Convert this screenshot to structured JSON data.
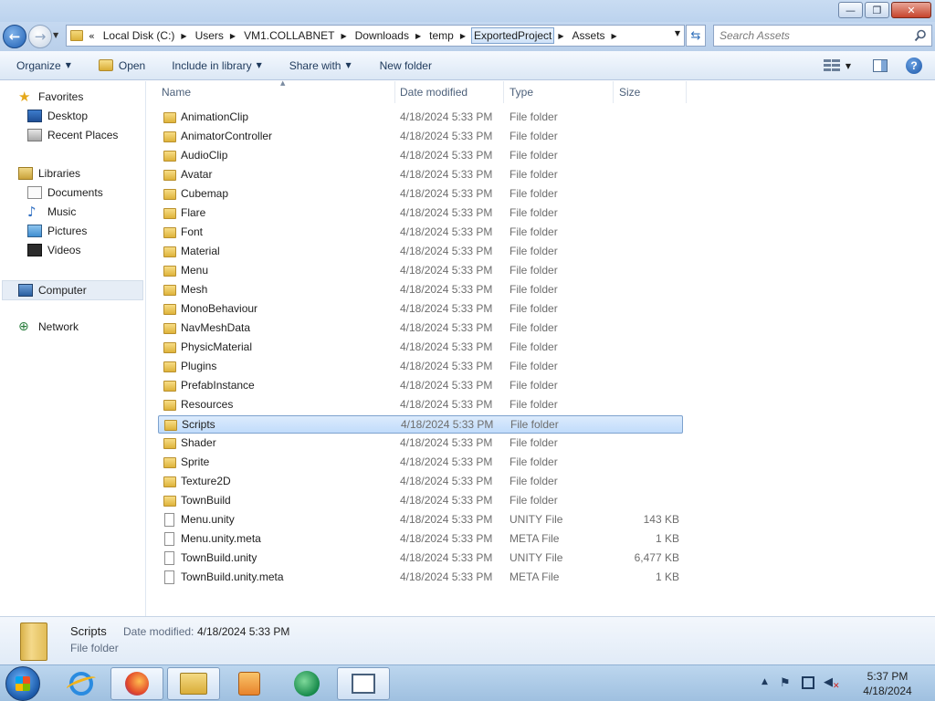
{
  "window": {
    "controls": {
      "minimize": "—",
      "maximize": "❐",
      "close": "✕"
    }
  },
  "address": {
    "overflow": "«",
    "crumbs": [
      "Local Disk (C:)",
      "Users",
      "VM1.COLLABNET",
      "Downloads",
      "temp",
      "ExportedProject",
      "Assets"
    ],
    "hover_index": 5
  },
  "search": {
    "placeholder": "Search Assets"
  },
  "toolbar": {
    "organize": "Organize",
    "open": "Open",
    "include_in_library": "Include in library",
    "share_with": "Share with",
    "new_folder": "New folder"
  },
  "nav": {
    "favorites": "Favorites",
    "desktop": "Desktop",
    "recent_places": "Recent Places",
    "libraries": "Libraries",
    "documents": "Documents",
    "music": "Music",
    "pictures": "Pictures",
    "videos": "Videos",
    "computer": "Computer",
    "network": "Network"
  },
  "columns": {
    "name": "Name",
    "date": "Date modified",
    "type": "Type",
    "size": "Size"
  },
  "files": [
    {
      "name": "AnimationClip",
      "date": "4/18/2024 5:33 PM",
      "type": "File folder",
      "size": "",
      "kind": "folder"
    },
    {
      "name": "AnimatorController",
      "date": "4/18/2024 5:33 PM",
      "type": "File folder",
      "size": "",
      "kind": "folder"
    },
    {
      "name": "AudioClip",
      "date": "4/18/2024 5:33 PM",
      "type": "File folder",
      "size": "",
      "kind": "folder"
    },
    {
      "name": "Avatar",
      "date": "4/18/2024 5:33 PM",
      "type": "File folder",
      "size": "",
      "kind": "folder"
    },
    {
      "name": "Cubemap",
      "date": "4/18/2024 5:33 PM",
      "type": "File folder",
      "size": "",
      "kind": "folder"
    },
    {
      "name": "Flare",
      "date": "4/18/2024 5:33 PM",
      "type": "File folder",
      "size": "",
      "kind": "folder"
    },
    {
      "name": "Font",
      "date": "4/18/2024 5:33 PM",
      "type": "File folder",
      "size": "",
      "kind": "folder"
    },
    {
      "name": "Material",
      "date": "4/18/2024 5:33 PM",
      "type": "File folder",
      "size": "",
      "kind": "folder"
    },
    {
      "name": "Menu",
      "date": "4/18/2024 5:33 PM",
      "type": "File folder",
      "size": "",
      "kind": "folder"
    },
    {
      "name": "Mesh",
      "date": "4/18/2024 5:33 PM",
      "type": "File folder",
      "size": "",
      "kind": "folder"
    },
    {
      "name": "MonoBehaviour",
      "date": "4/18/2024 5:33 PM",
      "type": "File folder",
      "size": "",
      "kind": "folder"
    },
    {
      "name": "NavMeshData",
      "date": "4/18/2024 5:33 PM",
      "type": "File folder",
      "size": "",
      "kind": "folder"
    },
    {
      "name": "PhysicMaterial",
      "date": "4/18/2024 5:33 PM",
      "type": "File folder",
      "size": "",
      "kind": "folder"
    },
    {
      "name": "Plugins",
      "date": "4/18/2024 5:33 PM",
      "type": "File folder",
      "size": "",
      "kind": "folder"
    },
    {
      "name": "PrefabInstance",
      "date": "4/18/2024 5:33 PM",
      "type": "File folder",
      "size": "",
      "kind": "folder"
    },
    {
      "name": "Resources",
      "date": "4/18/2024 5:33 PM",
      "type": "File folder",
      "size": "",
      "kind": "folder"
    },
    {
      "name": "Scripts",
      "date": "4/18/2024 5:33 PM",
      "type": "File folder",
      "size": "",
      "kind": "folder",
      "selected": true
    },
    {
      "name": "Shader",
      "date": "4/18/2024 5:33 PM",
      "type": "File folder",
      "size": "",
      "kind": "folder"
    },
    {
      "name": "Sprite",
      "date": "4/18/2024 5:33 PM",
      "type": "File folder",
      "size": "",
      "kind": "folder"
    },
    {
      "name": "Texture2D",
      "date": "4/18/2024 5:33 PM",
      "type": "File folder",
      "size": "",
      "kind": "folder"
    },
    {
      "name": "TownBuild",
      "date": "4/18/2024 5:33 PM",
      "type": "File folder",
      "size": "",
      "kind": "folder"
    },
    {
      "name": "Menu.unity",
      "date": "4/18/2024 5:33 PM",
      "type": "UNITY File",
      "size": "143 KB",
      "kind": "file"
    },
    {
      "name": "Menu.unity.meta",
      "date": "4/18/2024 5:33 PM",
      "type": "META File",
      "size": "1 KB",
      "kind": "file"
    },
    {
      "name": "TownBuild.unity",
      "date": "4/18/2024 5:33 PM",
      "type": "UNITY File",
      "size": "6,477 KB",
      "kind": "file"
    },
    {
      "name": "TownBuild.unity.meta",
      "date": "4/18/2024 5:33 PM",
      "type": "META File",
      "size": "1 KB",
      "kind": "file"
    }
  ],
  "details": {
    "name": "Scripts",
    "modified_label": "Date modified:",
    "modified_value": "4/18/2024 5:33 PM",
    "type": "File folder"
  },
  "taskbar": {
    "time": "5:37 PM",
    "date": "4/18/2024"
  }
}
